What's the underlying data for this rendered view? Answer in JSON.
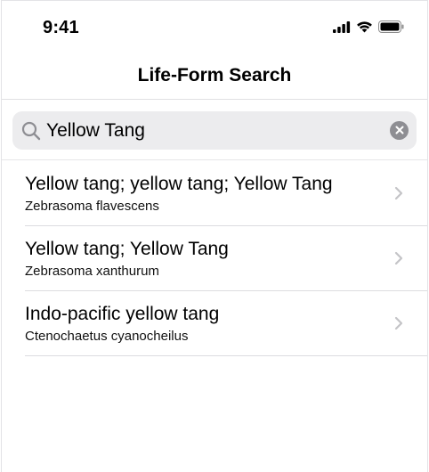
{
  "status_bar": {
    "time": "9:41",
    "icons": [
      "cellular-signal-icon",
      "wifi-icon",
      "battery-icon"
    ]
  },
  "nav": {
    "title": "Life-Form Search"
  },
  "search": {
    "value": "Yellow Tang",
    "icon": "search-icon",
    "clear_icon": "clear-icon"
  },
  "results": [
    {
      "common_names": "Yellow tang; yellow tang; Yellow Tang",
      "scientific_name": "Zebrasoma flavescens"
    },
    {
      "common_names": "Yellow tang; Yellow Tang",
      "scientific_name": "Zebrasoma xanthurum"
    },
    {
      "common_names": "Indo-pacific yellow tang",
      "scientific_name": "Ctenochaetus cyanocheilus"
    }
  ],
  "colors": {
    "search_field_bg": "#ececee",
    "clear_button_bg": "#8e8e93",
    "chevron": "#c4c4c7",
    "separator": "#dcdce0"
  }
}
